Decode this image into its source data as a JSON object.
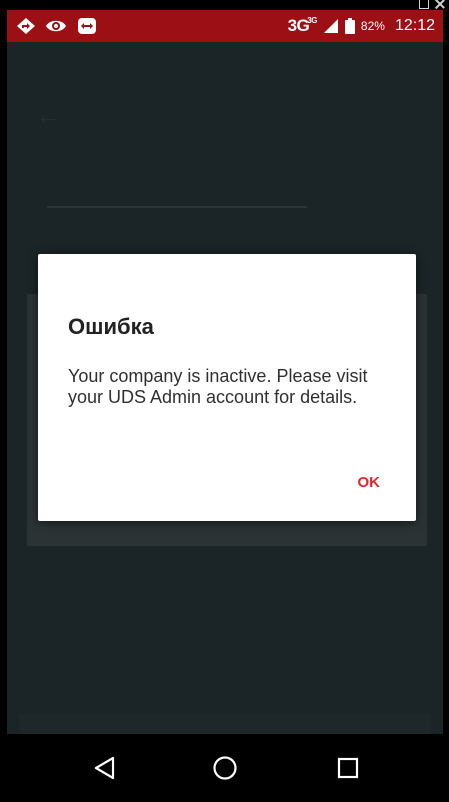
{
  "status_bar": {
    "network_type": "3G",
    "network_superscript": "3G",
    "battery_percent": "82%",
    "time": "12:12",
    "left_icons": [
      "navigation-arrow-icon",
      "eye-icon",
      "remote-control-icon"
    ],
    "right_icons": [
      "signal-icon",
      "battery-icon"
    ],
    "background_color": "#9b0f15"
  },
  "background_screen": {
    "background_color": "#1b2426"
  },
  "dialog": {
    "title": "Ошибка",
    "message": "Your company is inactive. Please visit your UDS Admin account for details.",
    "ok_label": "OK",
    "accent_color": "#e2242b"
  },
  "nav_bar": {
    "buttons": [
      "back-icon",
      "home-icon",
      "recents-icon"
    ]
  },
  "window_controls": {
    "icons": [
      "restore-icon",
      "close-icon"
    ]
  }
}
